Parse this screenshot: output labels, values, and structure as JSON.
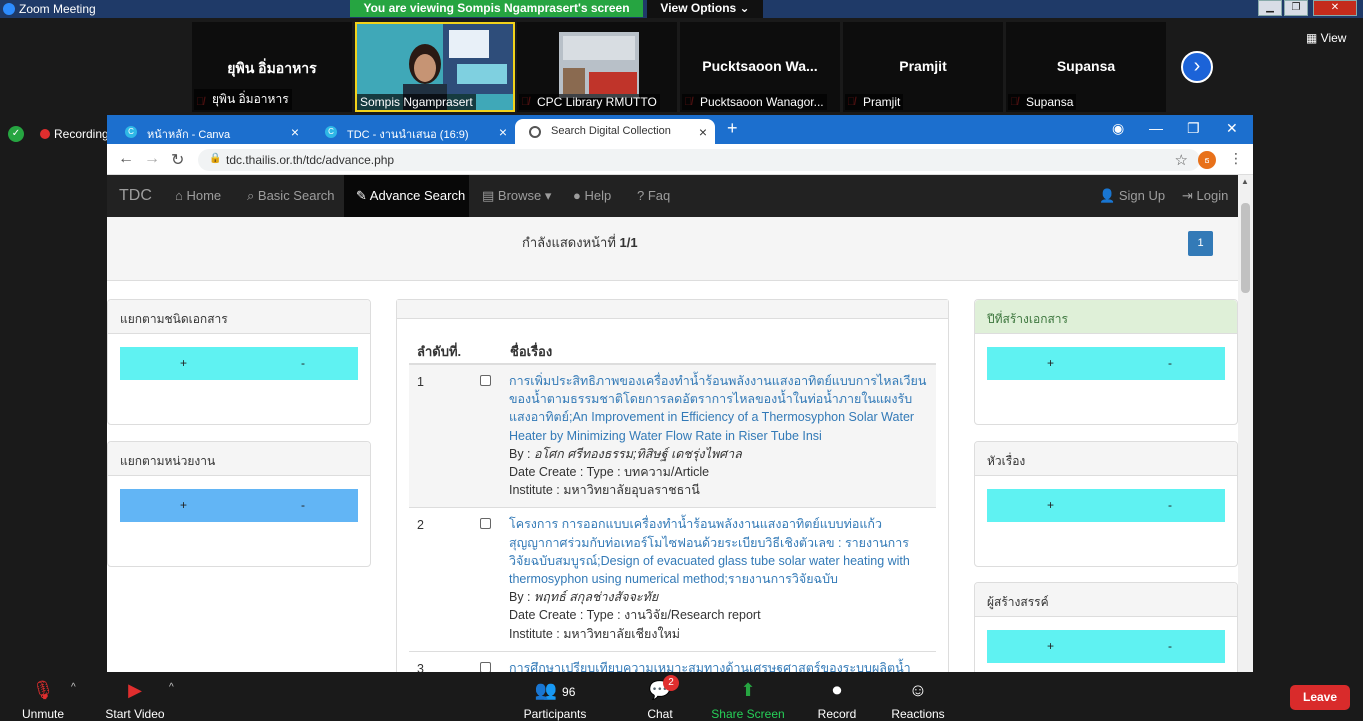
{
  "zoom": {
    "window_title": "Zoom Meeting",
    "viewing_banner": "You are viewing Sompis Ngamprasert's screen",
    "view_options": "View Options ⌄",
    "view_label": "View",
    "recording_label": "Recording",
    "participants": [
      {
        "big_name": "ยุพิน อิ่มอาหาร",
        "tag": "ยุพิน อิ่มอาหาร"
      },
      {
        "big_name": "",
        "tag": "Sompis Ngamprasert"
      },
      {
        "big_name": "",
        "tag": "CPC Library RMUTTO"
      },
      {
        "big_name": "Pucktsaoon  Wa...",
        "tag": "Pucktsaoon Wanagor..."
      },
      {
        "big_name": "Pramjit",
        "tag": "Pramjit"
      },
      {
        "big_name": "Supansa",
        "tag": "Supansa"
      }
    ],
    "bottom": {
      "unmute": "Unmute",
      "start_video": "Start Video",
      "participants": "Participants",
      "participants_count": "96",
      "chat": "Chat",
      "chat_badge": "2",
      "share_screen": "Share Screen",
      "record": "Record",
      "reactions": "Reactions",
      "leave": "Leave"
    }
  },
  "browser": {
    "tabs": [
      {
        "label": "หน้าหลัก - Canva",
        "icon": "C"
      },
      {
        "label": "TDC - งานนำเสนอ (16:9)",
        "icon": "C"
      },
      {
        "label": "Search Digital Collection",
        "icon": ""
      }
    ],
    "url": "tdc.thailis.or.th/tdc/advance.php",
    "profile_initial": "ธ"
  },
  "site": {
    "nav": {
      "brand": "TDC",
      "home": "Home",
      "basic_search": "Basic Search",
      "advance_search": "Advance Search",
      "browse": "Browse",
      "help": "Help",
      "faq": "Faq",
      "sign_up": "Sign Up",
      "login": "Login"
    },
    "pager_text_prefix": "กำลังแสดงหน้าที่ ",
    "pager_text_page": "1/1",
    "page_button": "1",
    "left_panels": [
      {
        "title": "แยกตามชนิดเอกสาร",
        "plus": "+",
        "minus": "-"
      },
      {
        "title": "แยกตามหน่วยงาน",
        "plus": "+",
        "minus": "-"
      }
    ],
    "right_panels": [
      {
        "title": "ปีที่สร้างเอกสาร",
        "plus": "+",
        "minus": "-"
      },
      {
        "title": "หัวเรื่อง",
        "plus": "+",
        "minus": "-"
      },
      {
        "title": "ผู้สร้างสรรค์",
        "plus": "+",
        "minus": "-"
      }
    ],
    "table": {
      "col_num": "ลำดับที่.",
      "col_title": "ชื่อเรื่อง",
      "rows": [
        {
          "num": "1",
          "title": "การเพิ่มประสิทธิภาพของเครื่องทำน้ำร้อนพลังงานแสงอาทิตย์แบบการไหลเวียนของน้ำตามธรรมชาติโดยการลดอัตราการไหลของน้ำในท่อน้ำภายในแผงรับแสงอาทิตย์;An Improvement in Efficiency of a Thermosyphon Solar Water Heater by Minimizing Water Flow Rate in Riser Tube Insi",
          "by_label": "By : ",
          "by": "อโศก ศรีทองธรรม;ทิสิษฐ์ เดชรุ่งไพศาล",
          "date_type": "Date Create : Type : บทความ/Article",
          "institute": "Institute : มหาวิทยาลัยอุบลราชธานี"
        },
        {
          "num": "2",
          "title": "โครงการ การออกแบบเครื่องทำน้ำร้อนพลังงานแสงอาทิตย์แบบท่อแก้วสุญญากาศร่วมกับท่อเทอร์โมไซฟอนด้วยระเบียบวิธีเชิงตัวเลข : รายงานการวิจัยฉบับสมบูรณ์;Design of evacuated glass tube solar water heating with thermosyphon using numerical method;รายงานการวิจัยฉบับ",
          "by_label": "By : ",
          "by": "พฤทธ์ สกุลช่างสัจจะทัย",
          "date_type": "Date Create : Type : งานวิจัย/Research report",
          "institute": "Institute : มหาวิทยาลัยเชียงใหม่"
        },
        {
          "num": "3",
          "title": "การศึกษาเปรียบเทียบความเหมาะสมทางด้านเศรษฐศาสตร์ของระบบผลิตน้ำ",
          "by_label": "",
          "by": "",
          "date_type": "",
          "institute": ""
        }
      ]
    }
  }
}
